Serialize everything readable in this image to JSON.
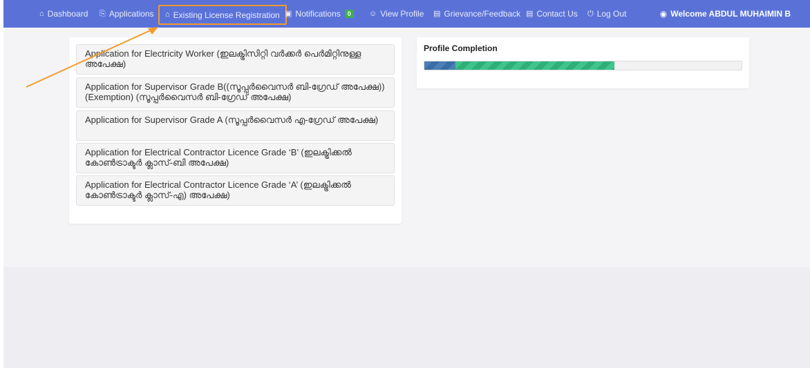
{
  "navbar": {
    "items": [
      {
        "icon": "⌂",
        "label": "Dashboard"
      },
      {
        "icon": "⎘",
        "label": "Applications"
      },
      {
        "icon": "⌂",
        "label": "Existing License Registration"
      },
      {
        "icon": "▣",
        "label": "Notifications",
        "badge": "0"
      },
      {
        "icon": "☺",
        "label": "View Profile"
      },
      {
        "icon": "▤",
        "label": "Grievance/Feedback"
      },
      {
        "icon": "▤",
        "label": "Contact Us"
      },
      {
        "icon": "⏻",
        "label": "Log Out"
      }
    ],
    "welcome_icon": "◉",
    "welcome_text": "Welcome ABDUL MUHAIMIN B"
  },
  "applications": [
    {
      "label": "Application for Electricity Worker (ഇലക്ട്രിസിറ്റി വർക്കർ പെർമിറ്റിനുള്ള അപേക്ഷ)"
    },
    {
      "label": "Application for Supervisor Grade B((സൂപ്പർവൈസർ ബി-ഗ്രേഡ് അപേക്ഷ)) (Exemption) (സൂപ്പർവൈസർ ബി-ഗ്രേഡ് അപേക്ഷ)"
    },
    {
      "label": "Application for Supervisor Grade A (സൂപ്പർവൈസർ എ-ഗ്രേഡ് അപേക്ഷ)"
    },
    {
      "label": "Application for Electrical Contractor Licence Grade ‘B’ (ഇലക്ട്രിക്കൽ കോൺട്രാക്ടർ ക്ലാസ്-ബി അപേക്ഷ)"
    },
    {
      "label": "Application for Electrical Contractor Licence Grade ‘A’ (ഇലക്ട്രിക്കൽ കോൺട്രാക്ടർ ക്ലാസ്-എ) അപേക്ഷ)"
    }
  ],
  "profile": {
    "title": "Profile Completion",
    "progress_fraction": 0.6
  },
  "colors": {
    "navbar": "#5a72d8",
    "highlight": "#f49a2c",
    "progress_green": "#3fc48c",
    "progress_blue": "#4a7fb8",
    "badge": "#3fae4f"
  }
}
